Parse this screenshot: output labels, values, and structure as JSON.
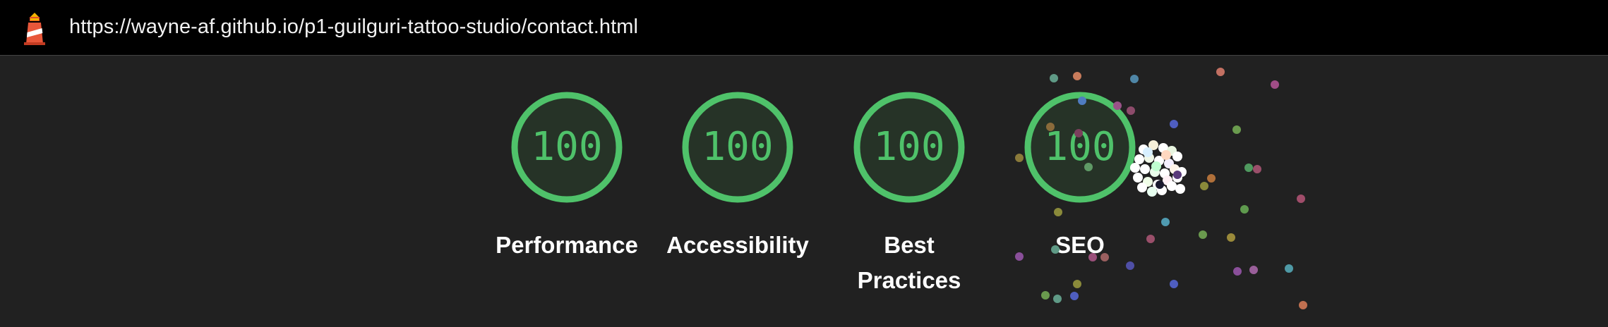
{
  "address_bar": {
    "url": "https://wayne-af.github.io/p1-guilguri-tattoo-studio/contact.html",
    "logo_icon": "lighthouse-icon"
  },
  "colors": {
    "pass": "#4fc26a",
    "ring_fill": "#263327",
    "background": "#212121",
    "topbar": "#000000"
  },
  "gauges": [
    {
      "score": "100",
      "label": "Performance"
    },
    {
      "score": "100",
      "label": "Accessibility"
    },
    {
      "score": "100",
      "label": "Best Practices"
    },
    {
      "score": "100",
      "label": "SEO"
    }
  ]
}
